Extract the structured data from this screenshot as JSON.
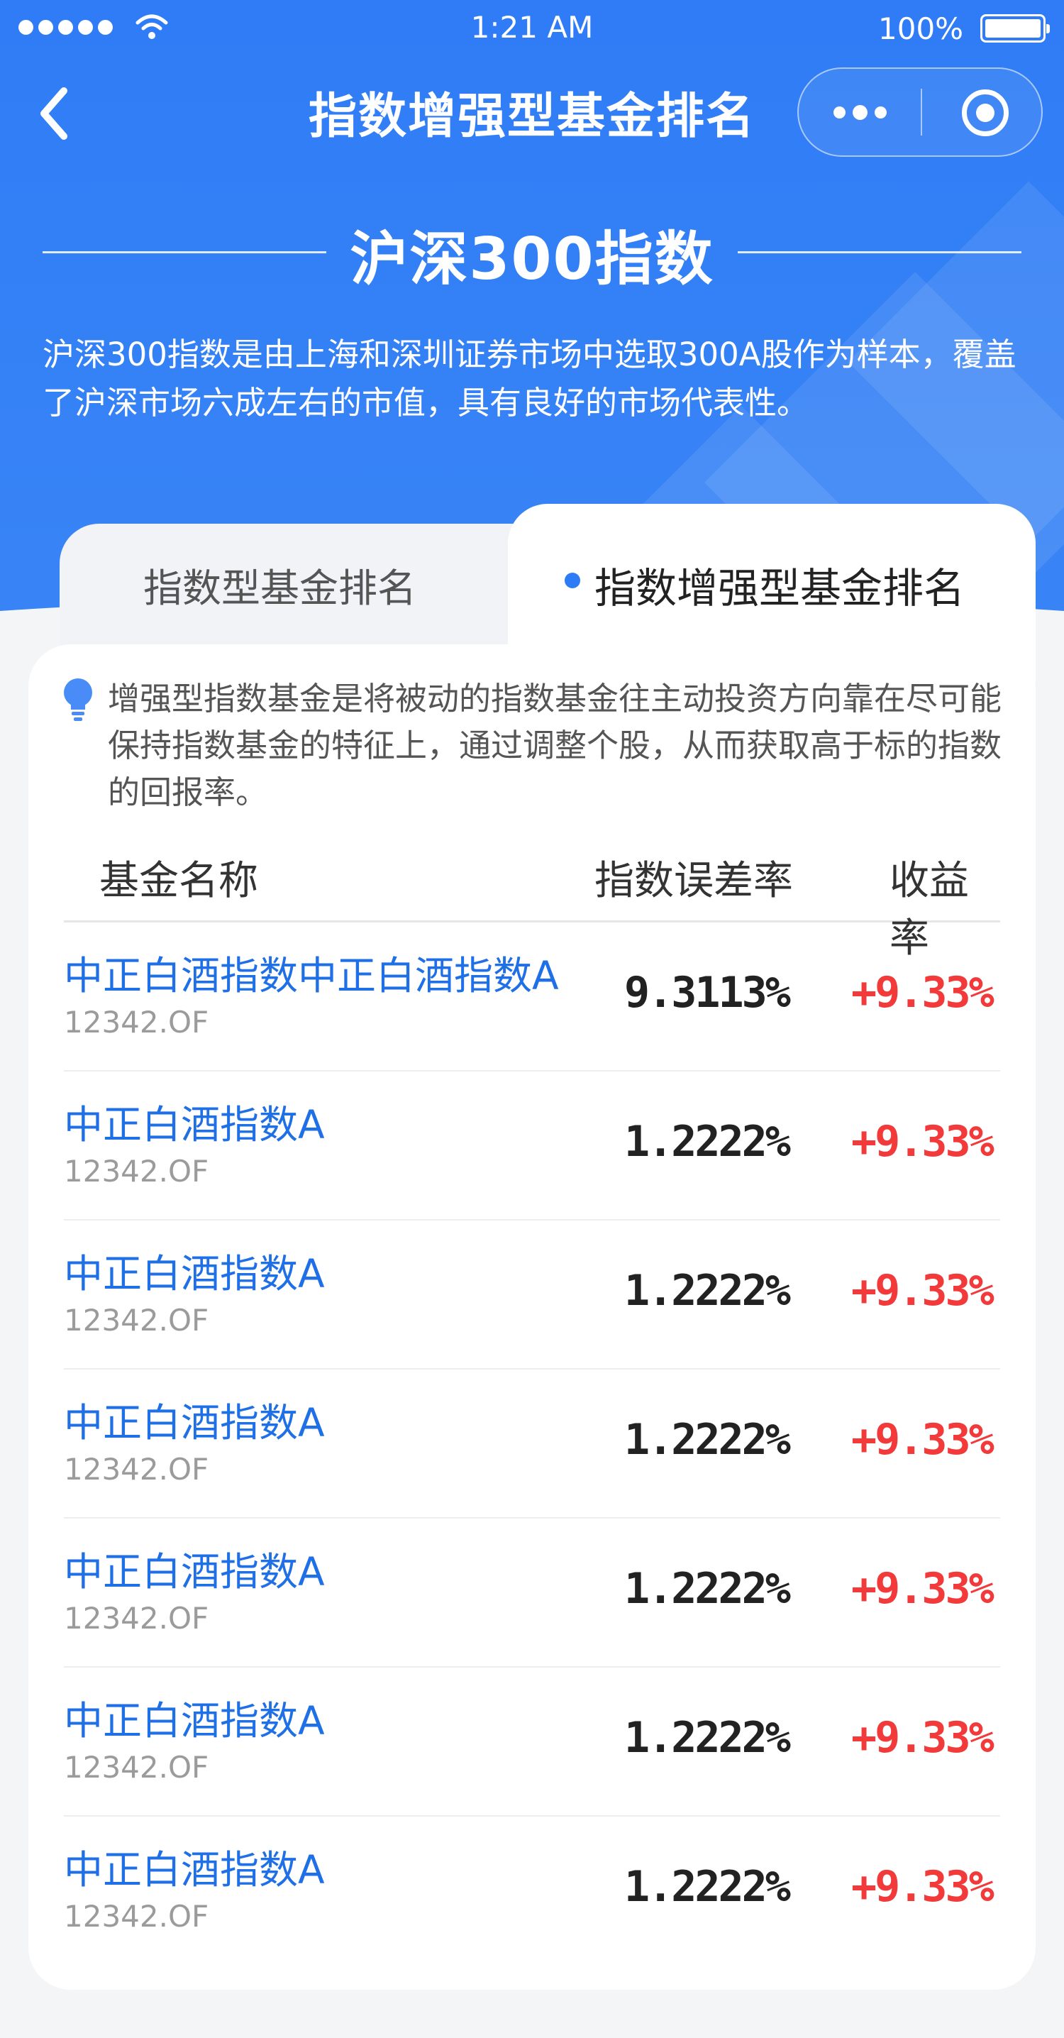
{
  "status_bar": {
    "time": "1:21 AM",
    "battery": "100%",
    "icons": [
      "signal-dots-icon",
      "wifi-icon",
      "battery-icon"
    ]
  },
  "nav": {
    "title": "指数增强型基金排名",
    "icons": [
      "back-arrow-icon",
      "more-dots-icon",
      "target-icon"
    ]
  },
  "index": {
    "title": "沪深300指数",
    "description": "沪深300指数是由上海和深圳证券市场中选取300A股作为样本，覆盖了沪深市场六成左右的市值，具有良好的市场代表性。"
  },
  "tabs": [
    {
      "label": "指数型基金排名",
      "active": false
    },
    {
      "label": "指数增强型基金排名",
      "active": true
    }
  ],
  "tip": {
    "icon": "lightbulb-icon",
    "text": "增强型指数基金是将被动的指数基金往主动投资方向靠在尽可能保持指数基金的特征上，通过调整个股，从而获取高于标的指数的回报率。"
  },
  "table": {
    "headers": [
      "基金名称",
      "指数误差率",
      "收益率"
    ],
    "rows": [
      {
        "name": "中正白酒指数中正白酒指数A",
        "code": "12342.OF",
        "error_rate": "9.3113%",
        "return_rate": "+9.33%"
      },
      {
        "name": "中正白酒指数A",
        "code": "12342.OF",
        "error_rate": "1.2222%",
        "return_rate": "+9.33%"
      },
      {
        "name": "中正白酒指数A",
        "code": "12342.OF",
        "error_rate": "1.2222%",
        "return_rate": "+9.33%"
      },
      {
        "name": "中正白酒指数A",
        "code": "12342.OF",
        "error_rate": "1.2222%",
        "return_rate": "+9.33%"
      },
      {
        "name": "中正白酒指数A",
        "code": "12342.OF",
        "error_rate": "1.2222%",
        "return_rate": "+9.33%"
      },
      {
        "name": "中正白酒指数A",
        "code": "12342.OF",
        "error_rate": "1.2222%",
        "return_rate": "+9.33%"
      },
      {
        "name": "中正白酒指数A",
        "code": "12342.OF",
        "error_rate": "1.2222%",
        "return_rate": "+9.33%"
      }
    ]
  },
  "colors": {
    "header_blue": "#2f7cf6",
    "link_blue": "#1f6fe6",
    "positive_red": "#f23a3a",
    "background": "#f4f5f7"
  }
}
